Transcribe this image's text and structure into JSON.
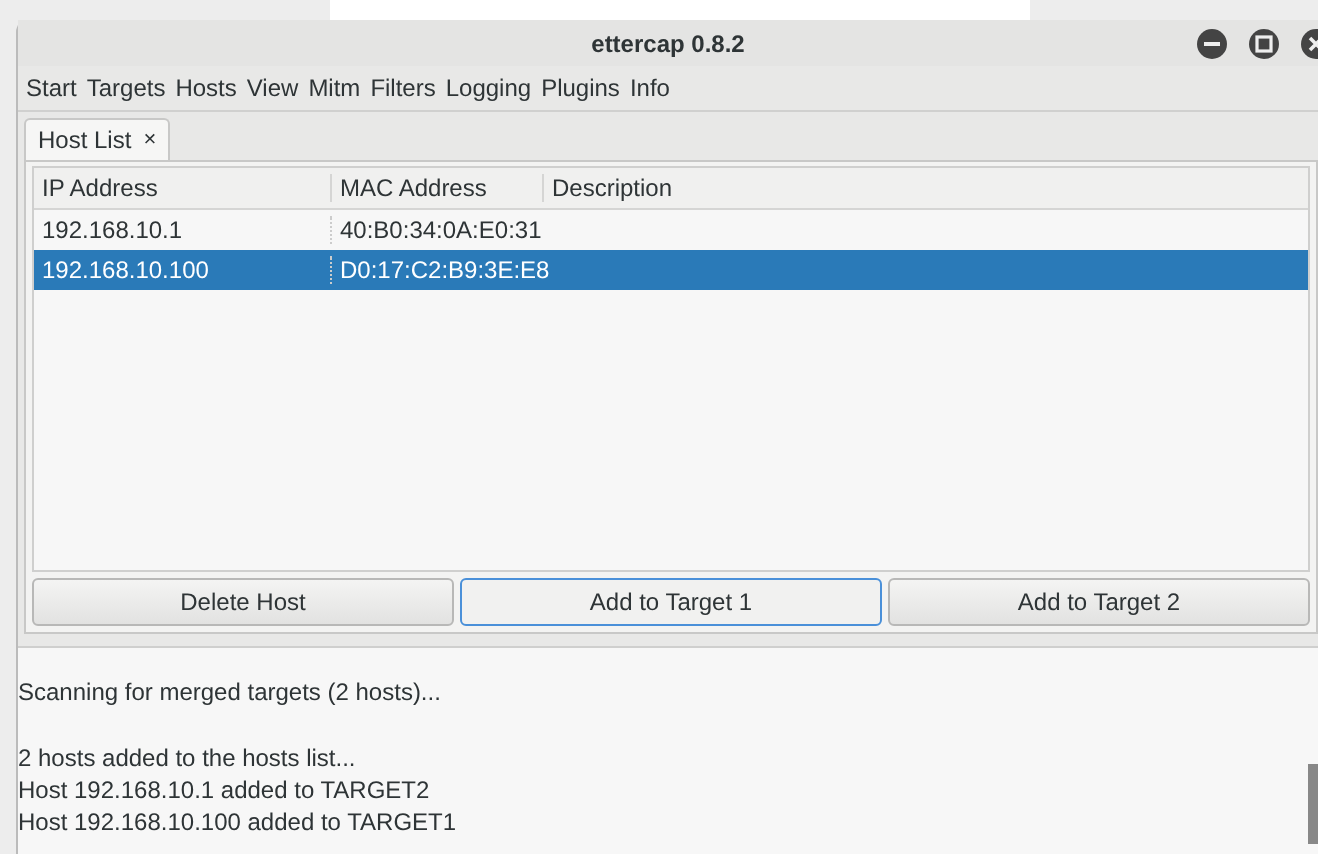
{
  "window": {
    "title": "ettercap 0.8.2"
  },
  "menu": [
    "Start",
    "Targets",
    "Hosts",
    "View",
    "Mitm",
    "Filters",
    "Logging",
    "Plugins",
    "Info"
  ],
  "tabs": [
    {
      "label": "Host List",
      "close": "×",
      "selected": true
    }
  ],
  "table": {
    "columns": [
      "IP Address",
      "MAC Address",
      "Description"
    ],
    "rows": [
      {
        "cells": [
          "192.168.10.1",
          "40:B0:34:0A:E0:31",
          ""
        ],
        "selected": false
      },
      {
        "cells": [
          "192.168.10.100",
          "D0:17:C2:B9:3E:E8",
          ""
        ],
        "selected": true
      }
    ]
  },
  "buttons": [
    {
      "label": "Delete Host",
      "focused": false
    },
    {
      "label": "Add to Target 1",
      "focused": true
    },
    {
      "label": "Add to Target 2",
      "focused": false
    }
  ],
  "log": [
    [
      "Scanning for merged targets (2 hosts)..."
    ],
    [
      "2 hosts added to the hosts list...",
      "Host 192.168.10.1 added to TARGET2",
      "Host 192.168.10.100 added to TARGET1"
    ]
  ]
}
